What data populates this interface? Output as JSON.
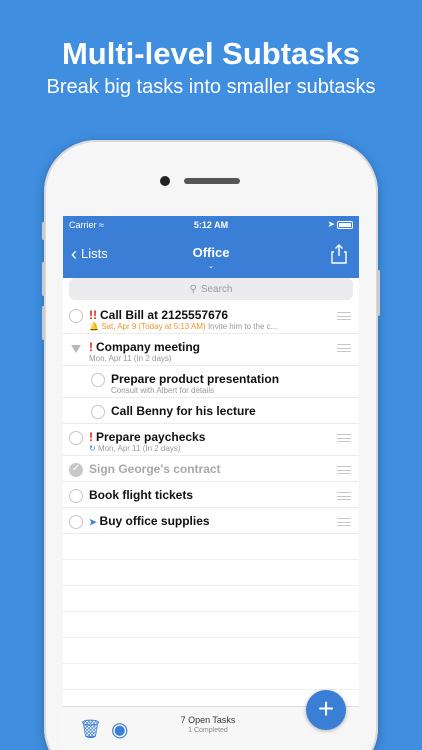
{
  "promo": {
    "headline": "Multi-level Subtasks",
    "subline": "Break big tasks into smaller subtasks"
  },
  "status": {
    "carrier": "Carrier",
    "time": "5:12 AM"
  },
  "nav": {
    "back_label": "Lists",
    "title": "Office"
  },
  "search": {
    "placeholder": "Search"
  },
  "tasks": [
    {
      "title": "Call Bill at 2125557676",
      "priority": "!!",
      "due": "Sat, Apr 9 (Today at 5:13 AM)",
      "note": "Invite him to the c..."
    },
    {
      "title": "Company meeting",
      "priority": "!",
      "due": "Mon, Apr 11 (In 2 days)"
    },
    {
      "title": "Prepare product presentation",
      "note": "Consult with Albert for details"
    },
    {
      "title": "Call Benny for his lecture"
    },
    {
      "title": "Prepare paychecks",
      "priority": "!",
      "due": "Mon, Apr 11 (In 2 days)"
    },
    {
      "title": "Sign George's contract"
    },
    {
      "title": "Book flight tickets"
    },
    {
      "title": "Buy office supplies"
    }
  ],
  "toolbar": {
    "open_tasks": "7 Open Tasks",
    "completed": "1 Completed"
  },
  "colors": {
    "background": "#3f8ee0",
    "accent": "#3a7fd5",
    "priority": "#e5261c",
    "due_today": "#f2922b"
  }
}
